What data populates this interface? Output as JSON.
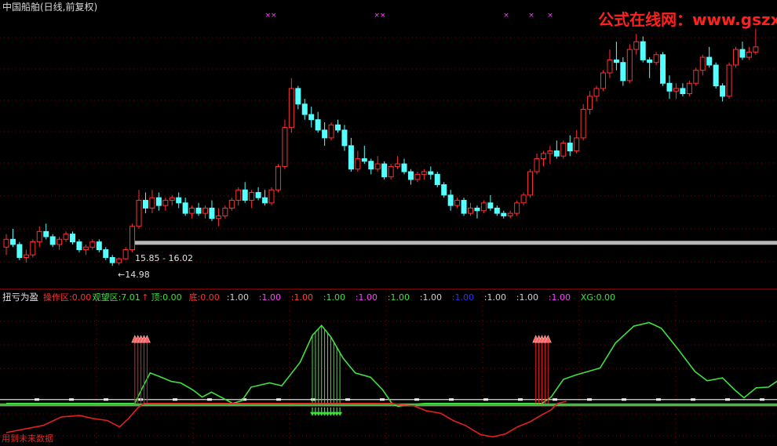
{
  "main_panel": {
    "title": "中国船舶(日线,前复权)",
    "watermark": "公式在线网：www.gszx.com.cn",
    "range_annotation": "15.85 - 16.02",
    "low_annotation": "←14.98"
  },
  "indicator_panel": {
    "title": "扭亏为盈",
    "stats": [
      {
        "label": "操作区:",
        "value": "0.00",
        "color": "#ff3030"
      },
      {
        "label": "观望区:",
        "value": "7.01",
        "color": "#40e040"
      },
      {
        "label": "↑",
        "value": "",
        "color": "#ff3030"
      },
      {
        "label": "顶:",
        "value": "0.00",
        "color": "#40e040"
      },
      {
        "label": "底:",
        "value": "0.00",
        "color": "#ff3030"
      },
      {
        "label": ":",
        "value": "1.00",
        "color": "#d0d0d0"
      },
      {
        "label": ":",
        "value": "1.00",
        "color": "#ff40ff"
      },
      {
        "label": ":",
        "value": "1.00",
        "color": "#ff4040"
      },
      {
        "label": ":",
        "value": "1.00",
        "color": "#40e040"
      },
      {
        "label": ":",
        "value": "1.00",
        "color": "#ff40ff"
      },
      {
        "label": ":",
        "value": "1.00",
        "color": "#40e040"
      },
      {
        "label": ":",
        "value": "1.00",
        "color": "#d0d0d0"
      },
      {
        "label": ":",
        "value": "1.00",
        "color": "#3030ff"
      },
      {
        "label": ":",
        "value": "1.00",
        "color": "#d0d0d0"
      },
      {
        "label": ":",
        "value": "1.00",
        "color": "#d0d0d0"
      },
      {
        "label": ":",
        "value": "1.00",
        "color": "#ff40ff"
      },
      {
        "label": "XG:",
        "value": "0.00",
        "color": "#40e040"
      }
    ],
    "footer_note": "用到未来数据"
  },
  "colors": {
    "background": "#000000",
    "up_candle": "#ff3030",
    "down_candle": "#54ffff",
    "divider": "#c00000",
    "grid": "#8a0000",
    "support_bar": "#b8b8b8",
    "green_line": "#40e040",
    "red_line": "#e02020",
    "markers": "#ff40ff",
    "watermark": "#ff2020"
  },
  "chart_data": [
    {
      "type": "candlestick",
      "title": "中国船舶(日线,前复权)",
      "top_markers": [
        "××",
        "××",
        "×",
        "×",
        "×"
      ],
      "ohlc": [
        [
          15.7,
          16.2,
          15.4,
          16.0
        ],
        [
          16.0,
          16.4,
          15.7,
          15.8
        ],
        [
          15.8,
          15.9,
          15.2,
          15.3
        ],
        [
          15.3,
          15.6,
          15.1,
          15.4
        ],
        [
          15.4,
          16.0,
          15.3,
          15.9
        ],
        [
          15.9,
          16.5,
          15.7,
          16.3
        ],
        [
          16.3,
          16.6,
          16.0,
          16.1
        ],
        [
          16.1,
          16.2,
          15.7,
          15.8
        ],
        [
          15.8,
          16.1,
          15.6,
          16.0
        ],
        [
          16.0,
          16.3,
          15.9,
          16.2
        ],
        [
          16.2,
          16.3,
          15.8,
          15.9
        ],
        [
          15.9,
          16.0,
          15.5,
          15.6
        ],
        [
          15.6,
          15.8,
          15.4,
          15.7
        ],
        [
          15.7,
          16.0,
          15.6,
          15.9
        ],
        [
          15.9,
          16.0,
          15.5,
          15.6
        ],
        [
          15.6,
          15.7,
          15.2,
          15.3
        ],
        [
          15.3,
          15.4,
          14.98,
          15.1
        ],
        [
          15.1,
          15.3,
          15.0,
          15.25
        ],
        [
          15.25,
          15.7,
          15.2,
          15.6
        ],
        [
          15.6,
          16.6,
          15.5,
          16.5
        ],
        [
          16.5,
          17.9,
          16.4,
          17.5
        ],
        [
          17.5,
          17.8,
          17.0,
          17.2
        ],
        [
          17.2,
          17.9,
          17.0,
          17.6
        ],
        [
          17.6,
          17.8,
          17.1,
          17.3
        ],
        [
          17.3,
          17.6,
          17.1,
          17.5
        ],
        [
          17.5,
          17.7,
          17.3,
          17.6
        ],
        [
          17.6,
          17.8,
          17.2,
          17.4
        ],
        [
          17.4,
          17.6,
          16.9,
          17.0
        ],
        [
          17.0,
          17.3,
          16.8,
          17.2
        ],
        [
          17.2,
          17.4,
          16.9,
          17.0
        ],
        [
          17.0,
          17.3,
          16.8,
          17.2
        ],
        [
          17.2,
          17.5,
          16.7,
          16.8
        ],
        [
          16.8,
          17.2,
          16.5,
          16.9
        ],
        [
          16.9,
          17.3,
          16.8,
          17.2
        ],
        [
          17.2,
          17.6,
          17.1,
          17.5
        ],
        [
          17.5,
          18.0,
          17.3,
          17.9
        ],
        [
          17.9,
          18.2,
          17.4,
          17.5
        ],
        [
          17.5,
          17.9,
          17.2,
          17.8
        ],
        [
          17.8,
          18.0,
          17.5,
          17.6
        ],
        [
          17.6,
          17.9,
          17.3,
          17.4
        ],
        [
          17.4,
          18.0,
          17.3,
          17.9
        ],
        [
          17.9,
          18.9,
          17.8,
          18.8
        ],
        [
          18.8,
          20.6,
          18.7,
          20.3
        ],
        [
          20.3,
          22.2,
          20.1,
          21.8
        ],
        [
          21.8,
          21.9,
          21.0,
          21.2
        ],
        [
          21.2,
          21.4,
          20.6,
          20.8
        ],
        [
          20.8,
          21.1,
          20.3,
          20.6
        ],
        [
          20.6,
          20.9,
          20.1,
          20.2
        ],
        [
          20.2,
          20.5,
          19.6,
          19.9
        ],
        [
          19.9,
          20.5,
          19.8,
          20.4
        ],
        [
          20.4,
          20.6,
          20.1,
          20.2
        ],
        [
          20.2,
          20.4,
          19.4,
          19.6
        ],
        [
          19.6,
          19.9,
          18.6,
          18.7
        ],
        [
          18.7,
          19.4,
          18.6,
          19.1
        ],
        [
          19.1,
          19.6,
          18.9,
          19.0
        ],
        [
          19.0,
          19.1,
          18.5,
          18.7
        ],
        [
          18.7,
          19.2,
          18.6,
          18.9
        ],
        [
          18.9,
          19.0,
          18.3,
          18.4
        ],
        [
          18.4,
          18.9,
          18.3,
          18.8
        ],
        [
          18.8,
          19.2,
          18.7,
          18.9
        ],
        [
          18.9,
          19.1,
          18.5,
          18.6
        ],
        [
          18.6,
          18.7,
          18.1,
          18.3
        ],
        [
          18.3,
          18.6,
          18.2,
          18.5
        ],
        [
          18.5,
          18.7,
          18.3,
          18.6
        ],
        [
          18.6,
          18.8,
          18.3,
          18.5
        ],
        [
          18.5,
          18.6,
          18.0,
          18.1
        ],
        [
          18.1,
          18.2,
          17.6,
          17.7
        ],
        [
          17.7,
          17.9,
          17.1,
          17.3
        ],
        [
          17.3,
          17.6,
          17.2,
          17.5
        ],
        [
          17.5,
          17.6,
          16.9,
          17.0
        ],
        [
          17.0,
          17.4,
          16.9,
          17.2
        ],
        [
          17.2,
          17.3,
          16.8,
          17.1
        ],
        [
          17.1,
          17.5,
          17.0,
          17.4
        ],
        [
          17.4,
          17.7,
          17.1,
          17.2
        ],
        [
          17.2,
          17.3,
          16.9,
          17.0
        ],
        [
          17.0,
          17.1,
          16.8,
          16.9
        ],
        [
          16.9,
          17.1,
          16.8,
          17.0
        ],
        [
          17.0,
          17.5,
          16.9,
          17.4
        ],
        [
          17.4,
          17.8,
          17.3,
          17.7
        ],
        [
          17.7,
          18.7,
          17.6,
          18.6
        ],
        [
          18.6,
          19.3,
          18.5,
          19.1
        ],
        [
          19.1,
          19.4,
          18.8,
          19.3
        ],
        [
          19.3,
          19.6,
          18.9,
          19.4
        ],
        [
          19.4,
          19.8,
          19.1,
          19.2
        ],
        [
          19.2,
          19.8,
          19.1,
          19.7
        ],
        [
          19.7,
          20.0,
          19.2,
          19.4
        ],
        [
          19.4,
          20.2,
          19.3,
          19.9
        ],
        [
          19.9,
          21.2,
          19.8,
          21.0
        ],
        [
          21.0,
          21.7,
          20.8,
          21.5
        ],
        [
          21.5,
          21.9,
          21.3,
          21.8
        ],
        [
          21.8,
          22.5,
          21.7,
          22.4
        ],
        [
          22.4,
          23.3,
          22.2,
          22.9
        ],
        [
          22.9,
          23.6,
          22.5,
          22.8
        ],
        [
          22.8,
          23.0,
          21.9,
          22.1
        ],
        [
          22.1,
          23.5,
          22.0,
          23.3
        ],
        [
          23.3,
          23.9,
          23.1,
          23.6
        ],
        [
          23.6,
          23.8,
          22.8,
          22.9
        ],
        [
          22.9,
          23.0,
          22.2,
          22.8
        ],
        [
          22.8,
          23.2,
          22.7,
          23.1
        ],
        [
          23.1,
          23.2,
          21.9,
          22.0
        ],
        [
          22.0,
          22.3,
          21.4,
          21.7
        ],
        [
          21.7,
          22.0,
          21.4,
          21.8
        ],
        [
          21.8,
          22.0,
          21.5,
          21.6
        ],
        [
          21.6,
          22.1,
          21.5,
          22.0
        ],
        [
          22.0,
          22.6,
          21.9,
          22.5
        ],
        [
          22.5,
          23.1,
          22.3,
          23.0
        ],
        [
          23.0,
          23.4,
          22.6,
          22.7
        ],
        [
          22.7,
          22.8,
          21.8,
          21.9
        ],
        [
          21.9,
          22.0,
          21.3,
          21.5
        ],
        [
          21.5,
          22.8,
          21.4,
          22.7
        ],
        [
          22.7,
          23.4,
          22.6,
          23.3
        ],
        [
          23.3,
          23.6,
          22.9,
          23.0
        ],
        [
          23.0,
          23.4,
          22.9,
          23.2
        ],
        [
          23.2,
          24.1,
          23.1,
          23.4
        ]
      ],
      "support_level": 15.85,
      "range_label": "15.85 - 16.02",
      "low_label": "←14.98",
      "ylim": [
        14.2,
        24.6
      ]
    },
    {
      "type": "line",
      "title": "扭亏为盈",
      "ylim": [
        -5,
        14
      ],
      "baseline": 0,
      "series": [
        {
          "name": "观望区",
          "color": "#40e040",
          "points": [
            [
              0,
              0
            ],
            [
              42,
              0
            ],
            [
              44,
              1.8
            ],
            [
              47,
              4.3
            ],
            [
              50,
              3.8
            ],
            [
              54,
              3.1
            ],
            [
              57,
              2.9
            ],
            [
              61,
              1.9
            ],
            [
              64,
              0.9
            ],
            [
              67,
              1.6
            ],
            [
              71,
              0.7
            ],
            [
              74,
              0.0
            ],
            [
              77,
              0.4
            ],
            [
              80,
              2.3
            ],
            [
              86,
              2.9
            ],
            [
              90,
              2.5
            ],
            [
              96,
              5.8
            ],
            [
              100,
              9.6
            ],
            [
              103,
              11.0
            ],
            [
              106,
              9.4
            ],
            [
              110,
              6.4
            ],
            [
              114,
              4.3
            ],
            [
              119,
              3.7
            ],
            [
              123,
              1.9
            ],
            [
              126,
              0.0
            ],
            [
              128,
              -0.4
            ],
            [
              131,
              -0.2
            ],
            [
              137,
              0.0
            ],
            [
              170,
              0.0
            ],
            [
              175,
              0.0
            ],
            [
              178,
              0.9
            ],
            [
              182,
              3.4
            ],
            [
              186,
              4.0
            ],
            [
              190,
              4.5
            ],
            [
              194,
              5.0
            ],
            [
              199,
              8.5
            ],
            [
              205,
              10.9
            ],
            [
              210,
              11.4
            ],
            [
              214,
              10.6
            ],
            [
              219,
              7.9
            ],
            [
              225,
              4.5
            ],
            [
              229,
              3.2
            ],
            [
              234,
              3.6
            ],
            [
              238,
              1.9
            ],
            [
              241,
              0.8
            ],
            [
              245,
              2.2
            ],
            [
              249,
              2.3
            ],
            [
              253,
              3.5
            ]
          ]
        },
        {
          "name": "",
          "color": "#e02020",
          "points": [
            [
              0,
              -4.1
            ],
            [
              6,
              -3.6
            ],
            [
              12,
              -3.1
            ],
            [
              18,
              -1.9
            ],
            [
              24,
              -1.7
            ],
            [
              28,
              -2.1
            ],
            [
              33,
              -2.4
            ],
            [
              37,
              -3.3
            ],
            [
              40,
              -2.1
            ],
            [
              43,
              -0.6
            ],
            [
              45,
              0.0
            ],
            [
              126,
              0.0
            ],
            [
              129,
              -0.2
            ],
            [
              133,
              -0.3
            ],
            [
              137,
              -1.0
            ],
            [
              142,
              -1.4
            ],
            [
              146,
              -2.4
            ],
            [
              150,
              -3.1
            ],
            [
              155,
              -4.4
            ],
            [
              159,
              -4.7
            ],
            [
              163,
              -4.3
            ],
            [
              167,
              -3.3
            ],
            [
              171,
              -2.6
            ],
            [
              175,
              -1.6
            ],
            [
              178,
              -0.9
            ],
            [
              180,
              0.0
            ],
            [
              183,
              0.3
            ]
          ]
        }
      ],
      "buy_signals_up": [
        42,
        43,
        44,
        45,
        46,
        173,
        174,
        175,
        176,
        177
      ],
      "sell_signals_down": [
        100,
        101,
        102,
        103,
        104,
        105,
        106,
        107,
        108,
        109
      ],
      "green_drop_lines": [
        100,
        101,
        102,
        103,
        104,
        105,
        106,
        107,
        108,
        109
      ]
    }
  ]
}
